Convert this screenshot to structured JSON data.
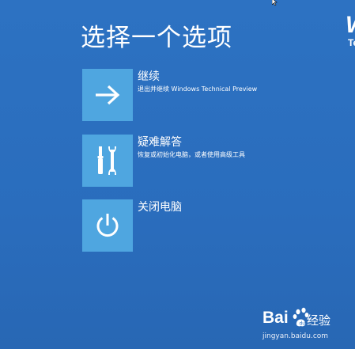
{
  "screen": {
    "title": "选择一个选项",
    "brand_fragment": "W",
    "brand_fragment_2": "Te"
  },
  "options": [
    {
      "label": "继续",
      "description": "退出并继续 Windows Technical Preview",
      "icon": "arrow-right-icon"
    },
    {
      "label": "疑难解答",
      "description": "恢复或初始化电脑，或者使用高级工具",
      "icon": "tools-icon"
    },
    {
      "label": "关闭电脑",
      "description": "",
      "icon": "power-icon"
    }
  ],
  "watermark": {
    "brand": "Bai",
    "brand_suffix": "经验",
    "url": "jingyan.baidu.com"
  },
  "colors": {
    "background": "#2a6fbf",
    "tile": "#4fa6e0",
    "text": "#ffffff"
  }
}
